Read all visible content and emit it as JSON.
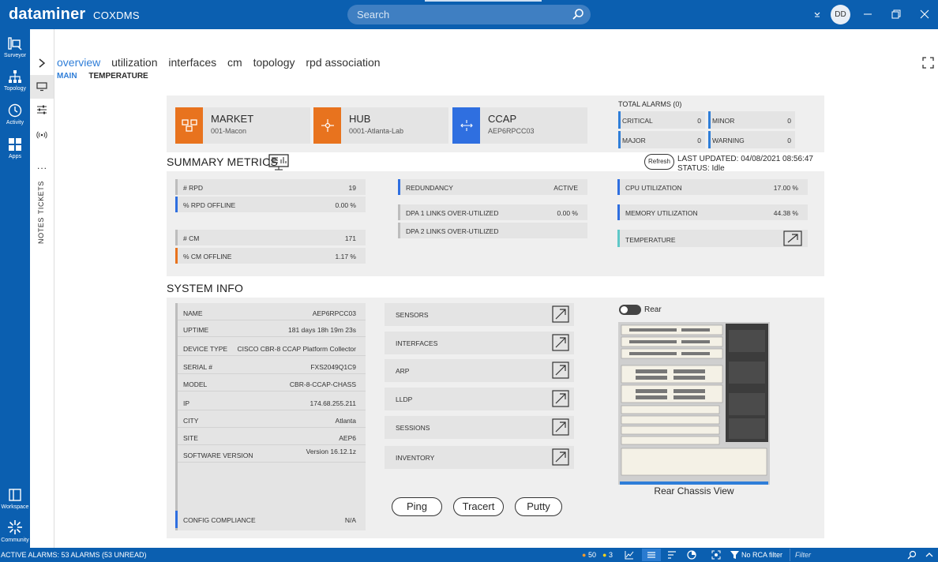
{
  "topbar": {
    "brand": "dataminer",
    "instance": "COXDMS",
    "search_placeholder": "Search",
    "user_initials": "DD"
  },
  "leftnav": {
    "items": [
      {
        "label": "Surveyor"
      },
      {
        "label": "Topology"
      },
      {
        "label": "Activity"
      },
      {
        "label": "Apps"
      },
      {
        "label": "Workspace"
      },
      {
        "label": "Community"
      }
    ]
  },
  "rail": {
    "more": "...",
    "tickets": "TICKETS",
    "notes": "NOTES"
  },
  "tabs": [
    "overview",
    "utilization",
    "interfaces",
    "cm",
    "topology",
    "rpd association"
  ],
  "subtabs": [
    "MAIN",
    "TEMPERATURE"
  ],
  "header_tiles": [
    {
      "title": "MARKET",
      "value": "001-Macon",
      "color": "#e8731e"
    },
    {
      "title": "HUB",
      "value": "0001-Atlanta-Lab",
      "color": "#e8731e"
    },
    {
      "title": "CCAP",
      "value": "AEP6RPCC03",
      "color": "#2f6fe0"
    }
  ],
  "alarms": {
    "title": "TOTAL ALARMS (0)",
    "critical": {
      "label": "CRITICAL",
      "value": "0"
    },
    "minor": {
      "label": "MINOR",
      "value": "0"
    },
    "major": {
      "label": "MAJOR",
      "value": "0"
    },
    "warning": {
      "label": "WARNING",
      "value": "0"
    }
  },
  "summary": {
    "title": "SUMMARY METRICS",
    "refresh": "Refresh",
    "last_updated": "LAST UPDATED: 04/08/2021 08:56:47",
    "status": "STATUS: Idle",
    "rpd": {
      "label": "# RPD",
      "value": "19"
    },
    "rpd_offline": {
      "label": "% RPD OFFLINE",
      "value": "0.00 %"
    },
    "cm": {
      "label": "# CM",
      "value": "171"
    },
    "cm_offline": {
      "label": "% CM OFFLINE",
      "value": "1.17 %"
    },
    "redundancy": {
      "label": "REDUNDANCY",
      "value": "ACTIVE"
    },
    "dpa1": {
      "label": "DPA 1 LINKS OVER-UTILIZED",
      "value": "0.00 %"
    },
    "dpa2": {
      "label": "DPA 2 LINKS OVER-UTILIZED",
      "value": ""
    },
    "cpu": {
      "label": "CPU UTILIZATION",
      "value": "17.00 %"
    },
    "memory": {
      "label": "MEMORY UTILIZATION",
      "value": "44.38 %"
    },
    "temperature": {
      "label": "TEMPERATURE"
    }
  },
  "sysinfo": {
    "title": "SYSTEM INFO",
    "rows": [
      {
        "label": "NAME",
        "value": "AEP6RPCC03"
      },
      {
        "label": "UPTIME",
        "value": "181 days 18h 19m 23s"
      },
      {
        "label": "DEVICE TYPE",
        "value": "CISCO CBR-8 CCAP Platform Collector"
      },
      {
        "label": "SERIAL #",
        "value": "FXS2049Q1C9"
      },
      {
        "label": "MODEL",
        "value": "CBR-8-CCAP-CHASS"
      },
      {
        "label": "IP",
        "value": "174.68.255.211"
      },
      {
        "label": "CITY",
        "value": "Atlanta"
      },
      {
        "label": "SITE",
        "value": "AEP6"
      },
      {
        "label": "SOFTWARE VERSION",
        "value": "Version 16.12.1z"
      }
    ],
    "config": {
      "label": "CONFIG COMPLIANCE",
      "value": "N/A"
    },
    "links": [
      "SENSORS",
      "INTERFACES",
      "ARP",
      "LLDP",
      "SESSIONS",
      "INVENTORY"
    ],
    "buttons": [
      "Ping",
      "Tracert",
      "Putty"
    ],
    "rear_toggle": "Rear",
    "chassis_caption": "Rear Chassis View"
  },
  "statusbar": {
    "alarms": "ACTIVE ALARMS: 53 ALARMS (53 UNREAD)",
    "count_orange": "50",
    "count_yellow": "3",
    "rca": "No RCA filter",
    "filter_placeholder": "Filter"
  }
}
